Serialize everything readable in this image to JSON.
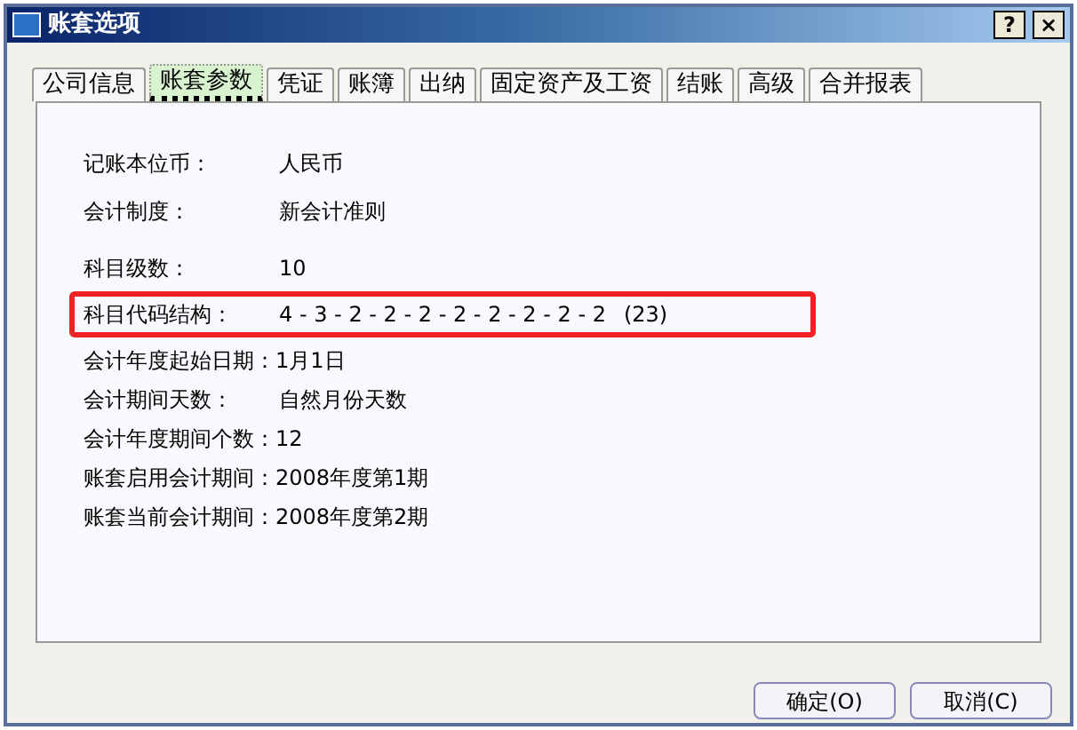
{
  "window": {
    "title": "账套选项",
    "help_button": "?",
    "close_button": "×"
  },
  "tabs": [
    {
      "label": "公司信息",
      "selected": false
    },
    {
      "label": "账套参数",
      "selected": true
    },
    {
      "label": "凭证",
      "selected": false
    },
    {
      "label": "账簿",
      "selected": false
    },
    {
      "label": "出纳",
      "selected": false
    },
    {
      "label": "固定资产及工资",
      "selected": false
    },
    {
      "label": "结账",
      "selected": false
    },
    {
      "label": "高级",
      "selected": false
    },
    {
      "label": "合并报表",
      "selected": false
    }
  ],
  "sections": [
    {
      "rows": [
        {
          "label": "记账本位币：",
          "value": "人民币",
          "kind": "aligned",
          "highlighted": false
        },
        {
          "label": "会计制度：",
          "value": "新会计准则",
          "kind": "aligned",
          "highlighted": false
        }
      ]
    },
    {
      "rows": [
        {
          "label": "科目级数：",
          "value": "10",
          "kind": "aligned",
          "highlighted": false
        },
        {
          "label": "科目代码结构：",
          "value": "4 - 3 - 2 - 2 - 2 - 2 - 2 - 2 - 2 - 2",
          "suffix": "(23)",
          "kind": "aligned",
          "highlighted": true
        },
        {
          "label": "会计年度起始日期：",
          "value": "1月1日",
          "kind": "inline",
          "highlighted": false
        },
        {
          "label": "会计期间天数：",
          "value": "自然月份天数",
          "kind": "aligned",
          "highlighted": false
        },
        {
          "label": "会计年度期间个数：",
          "value": "12",
          "kind": "inline",
          "highlighted": false
        },
        {
          "label": "账套启用会计期间：",
          "value": "2008年度第1期",
          "kind": "inline",
          "highlighted": false
        },
        {
          "label": "账套当前会计期间：",
          "value": "2008年度第2期",
          "kind": "inline",
          "highlighted": false
        }
      ]
    }
  ],
  "buttons": [
    {
      "label": "确定(O)"
    },
    {
      "label": "取消(C)"
    }
  ]
}
